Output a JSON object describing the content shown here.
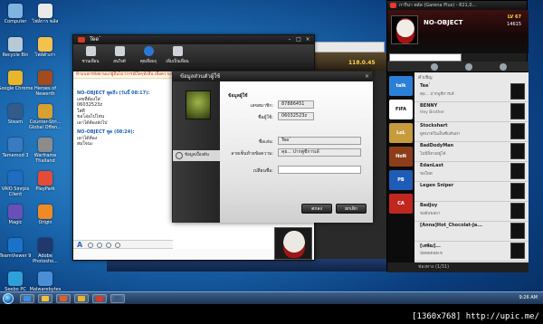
{
  "desktop_icons": [
    {
      "label": "Computer",
      "color": "#7fb3e0"
    },
    {
      "label": "ไฟล์การ พลัส",
      "color": "#e9e9e9"
    },
    {
      "label": "Recycle Bin",
      "color": "#b5c9d6"
    },
    {
      "label": "ไฟล์ตัวเก่า",
      "color": "#f2c14e"
    },
    {
      "label": "Google Chrome",
      "color": "#e8b62c"
    },
    {
      "label": "Heroes of Newerth",
      "color": "#a34a1e"
    },
    {
      "label": "Steam",
      "color": "#355b8a"
    },
    {
      "label": "Counter-Stri... Global Offen...",
      "color": "#d8a032"
    },
    {
      "label": "Tamemod 3",
      "color": "#3a7ac0"
    },
    {
      "label": "Warframe Thailand",
      "color": "#8c8c8c"
    },
    {
      "label": "VAIO Sinrpis Client",
      "color": "#1f6cc0"
    },
    {
      "label": "PlayPark",
      "color": "#e34c3a"
    },
    {
      "label": "Magic",
      "color": "#6a4fb8"
    },
    {
      "label": "Origin",
      "color": "#f08a24"
    },
    {
      "label": "TeamViewer 9",
      "color": "#1a73c9"
    },
    {
      "label": "Adobe Photosho...",
      "color": "#20386b"
    },
    {
      "label": "Seebo PC System",
      "color": "#2fa0d8"
    },
    {
      "label": "Malwarebytes Anti-Malware",
      "color": "#4a8fd6"
    }
  ],
  "taskbar": {
    "clock": "9:26 AM",
    "pinned": [
      {
        "name": "ie",
        "color": "#3a8ee6"
      },
      {
        "name": "explorer",
        "color": "#f0c040"
      },
      {
        "name": "media",
        "color": "#e25d2c"
      },
      {
        "name": "chrome",
        "color": "#e8b62c"
      },
      {
        "name": "garena",
        "color": "#d83a2a"
      },
      {
        "name": "steam",
        "color": "#355b8a"
      }
    ]
  },
  "watermark": "[1360x768] http://upic.me/",
  "background_window": {
    "stat": "118.0.45"
  },
  "chat_window": {
    "title": "Tee`",
    "tools": [
      "ชวนเพื่อน",
      "สนใจดี",
      "คุยเพื่อนๆ",
      "เพิ่มเป็นเพื่อน"
    ],
    "notice": "ห้ามบอกรหัสผ่านแก่ผู้อื่นไม่ว่ากรณีใดๆทั้งสิ้น เพื่อความปลอดภัยของบัญชี",
    "messages": [
      {
        "head": "NO-OBJECT พูดถึง (วันนี้ 08:17):",
        "lines": [
          "เลขที่ต้องใส่",
          "06032523z",
          "ใส่ดี",
          "ขอโอ่อไปไหน",
          "เดาได้ต้องส่งไป"
        ]
      },
      {
        "head": "NO-OBJECT พูด (08:24):",
        "lines": [
          "เดาได้ต้อง",
          "สมใจนะ"
        ]
      }
    ]
  },
  "profile_dialog": {
    "title": "ข้อมูลส่วนตัวผู้ใช้",
    "side_tab": "ข้อมูลเบื้องต้น",
    "section_user": "ข้อมูลผู้ใช้",
    "account_label": "เลขสมาชิก:",
    "account_value": "87886451",
    "username_label": "ชื่อผู้ใช้:",
    "username_value": "06032523z",
    "name_label": "ชื่อเล่น:",
    "name_value": "Tee`",
    "signature_label": "ลายเซ็นท้ายข้อความ:",
    "signature_value": "คุย... ปากพูชีการเด้",
    "change_label": "เปลี่ยนชื่อ:",
    "change_value": "",
    "ok_label": "ตกลง",
    "cancel_label": "ยกเลิก"
  },
  "garena": {
    "title": "การีน่า พลัส (Garena Plus) - 821,0...",
    "username": "NO-OBJECT",
    "level": "LV 67",
    "points": "14615",
    "group_header": "คำเชิญ",
    "games": [
      {
        "name": "talk",
        "color": "#2c7fd6"
      },
      {
        "name": "FIFA",
        "color": "#ffffff"
      },
      {
        "name": "LoL",
        "color": "#c79a3c"
      },
      {
        "name": "HoN",
        "color": "#8c3d1a"
      },
      {
        "name": "PB",
        "color": "#1f5cb5"
      },
      {
        "name": "CA",
        "color": "#c0281f"
      }
    ],
    "friends": [
      {
        "name": "Tee`",
        "status": "คุย... ปากพูชีการเด้"
      },
      {
        "name": "BENNY",
        "status": "Hey Brother"
      },
      {
        "name": "Stockshart",
        "status": "ดูดนาคในเอ็นซีแค้นผ่า"
      },
      {
        "name": "BadDodyMan",
        "status": "ไม่มีสิ่งกงอยู่ได้"
      },
      {
        "name": "EdanLast",
        "status": "ขอโผด"
      },
      {
        "name": "Legen Sniper",
        "status": ""
      },
      {
        "name": "BadJoy",
        "status": "ขอยับขอบา"
      },
      {
        "name": "[Anna]Hot_Chocolat-Ja...",
        "status": ""
      },
      {
        "name": "[เสพัฒ]...",
        "status": "นัดดยคอดเข"
      }
    ],
    "footer": "ช่องทาง (1/31)"
  }
}
